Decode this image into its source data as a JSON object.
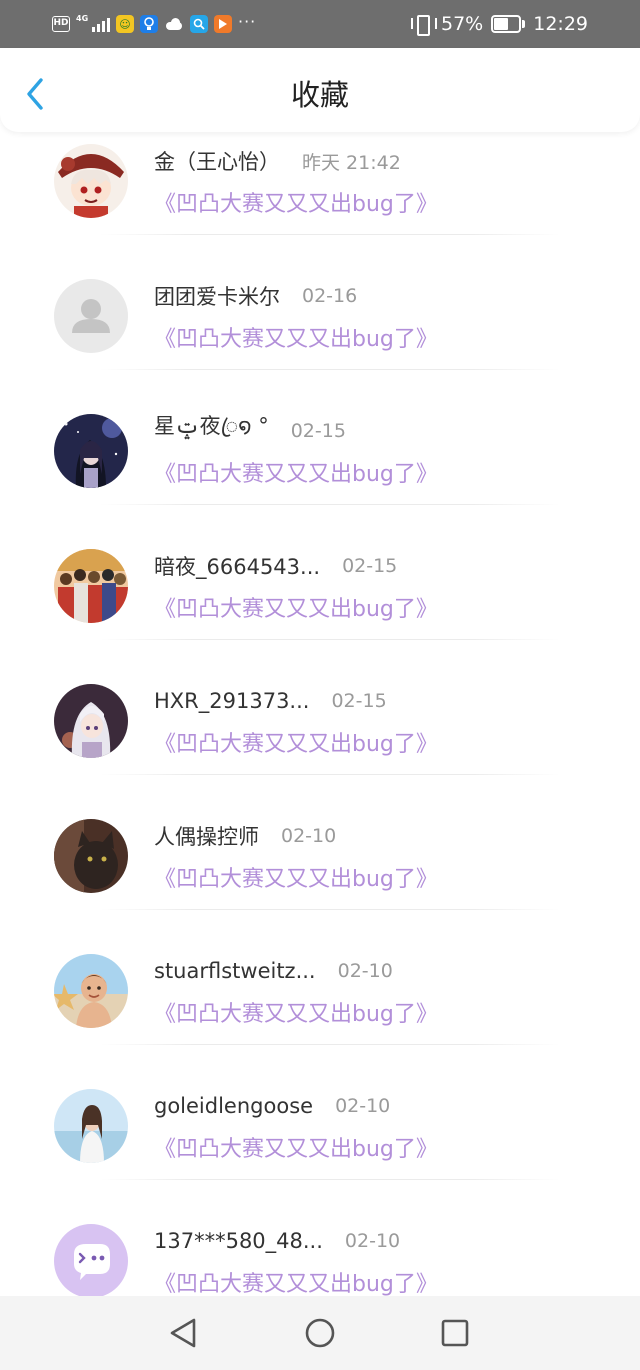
{
  "status_bar": {
    "hd": "HD",
    "network": "4G",
    "battery_text": "57%",
    "battery_level": 0.57,
    "time": "12:29",
    "icons": [
      "hd-icon",
      "signal-icon",
      "app-icon-1",
      "lightbulb-icon",
      "cloud-icon",
      "search-app-icon",
      "play-app-icon",
      "more-dots-icon",
      "vibrate-icon",
      "battery-icon"
    ]
  },
  "header": {
    "title": "收藏",
    "back_icon": "chevron-left-icon",
    "accent": "#2ea3e3"
  },
  "items": [
    {
      "name": "金（王心怡）",
      "time": "昨天 21:42",
      "title": "《凹凸大赛又又又出bug了》",
      "avatar": "anime-girl-red-hat"
    },
    {
      "name": "团团爱卡米尔",
      "time": "02-16",
      "title": "《凹凸大赛又又又出bug了》",
      "avatar": "default-user"
    },
    {
      "name": "星ݓ夜ꦿ໑ °",
      "time": "02-15",
      "title": "《凹凸大赛又又又出bug了》",
      "avatar": "anime-night-sky"
    },
    {
      "name": "暗夜_6664543...",
      "time": "02-15",
      "title": "《凹凸大赛又又又出bug了》",
      "avatar": "anime-group"
    },
    {
      "name": "HXR_291373...",
      "time": "02-15",
      "title": "《凹凸大赛又又又出bug了》",
      "avatar": "anime-silver-hair"
    },
    {
      "name": "人偶操控师",
      "time": "02-10",
      "title": "《凹凸大赛又又又出bug了》",
      "avatar": "cat-photo"
    },
    {
      "name": "stuarflstweitz...",
      "time": "02-10",
      "title": "《凹凸大赛又又又出bug了》",
      "avatar": "child-beach"
    },
    {
      "name": "goleidlengoose",
      "time": "02-10",
      "title": "《凹凸大赛又又又出bug了》",
      "avatar": "woman-sea"
    },
    {
      "name": "137***580_48...",
      "time": "02-10",
      "title": "《凹凸大赛又又又出bug了》",
      "avatar": "purple-chat-default"
    }
  ],
  "nav_bar": {
    "icons": [
      "back-triangle-icon",
      "home-circle-icon",
      "recents-square-icon"
    ]
  },
  "colors": {
    "post_title": "#b28fd9",
    "status_bar_bg": "#6e6e6e",
    "timestamp": "#9a9a9a"
  }
}
